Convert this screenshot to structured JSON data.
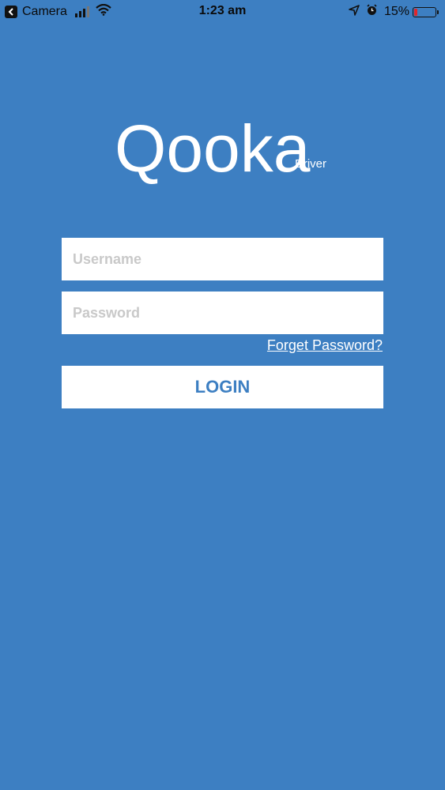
{
  "status_bar": {
    "back_label": "Camera",
    "time": "1:23 am",
    "battery_percent": "15%",
    "battery_level": 0.15,
    "battery_color": "#e0262a",
    "icons": [
      "chevron-left-icon",
      "signal-icon",
      "wifi-icon",
      "location-arrow-icon",
      "alarm-icon",
      "battery-icon"
    ]
  },
  "logo": {
    "name": "Qooka",
    "subtitle": "Driver"
  },
  "form": {
    "username_placeholder": "Username",
    "username_value": "",
    "password_placeholder": "Password",
    "password_value": "",
    "forgot_label": "Forget Password?",
    "login_label": "LOGIN"
  },
  "colors": {
    "background": "#3d7fc2",
    "button_text": "#3d7fc2",
    "field_background": "#ffffff",
    "placeholder": "#c9c9c9"
  }
}
